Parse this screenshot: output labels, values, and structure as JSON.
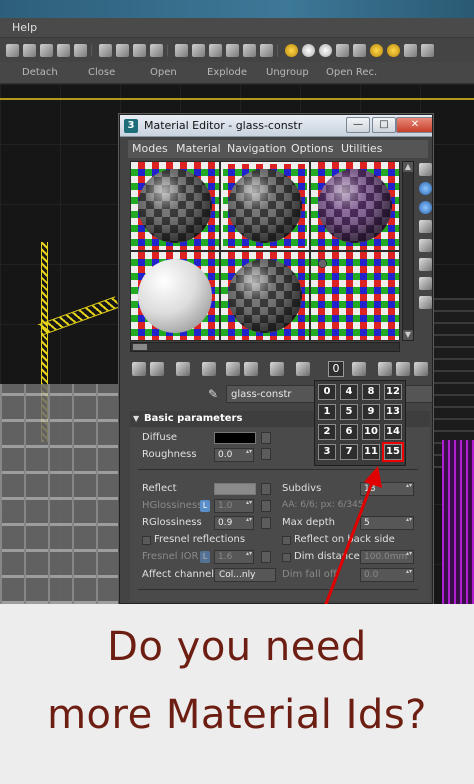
{
  "host": {
    "menu": {
      "help": "Help"
    },
    "labels": [
      "Detach",
      "Close",
      "Open",
      "Explode",
      "Ungroup",
      "Open Rec."
    ]
  },
  "editor": {
    "title": "Material Editor - glass-constr",
    "app_icon_text": "3",
    "window_buttons": {
      "minimize": "—",
      "maximize": "□",
      "close": "✕"
    },
    "menus": [
      "Modes",
      "Material",
      "Navigation",
      "Options",
      "Utilities"
    ],
    "material_name": "glass-constr",
    "material_type": "tl",
    "material_id_button": "0",
    "section_title": "Basic parameters",
    "fields": {
      "diffuse": "Diffuse",
      "roughness": "Roughness",
      "roughness_value": "0.0",
      "reflect": "Reflect",
      "hglossiness": "HGlossiness",
      "hglossiness_value": "1.0",
      "rglossiness": "RGlossiness",
      "rglossiness_value": "0.9",
      "fresnel_reflections": "Fresnel reflections",
      "fresnel_ior": "Fresnel IOR",
      "fresnel_ior_value": "1.6",
      "affect_channels": "Affect channels",
      "affect_channels_value": "Col...nly",
      "subdivs": "Subdivs",
      "subdivs_value": "18",
      "aa": "AA: 6/6; px: 6/345",
      "max_depth": "Max depth",
      "max_depth_value": "5",
      "reflect_on_back_side": "Reflect on back side",
      "dim_distance": "Dim distance",
      "dim_distance_value": "100.0mm",
      "dim_fall_off": "Dim fall off",
      "dim_fall_off_value": "0.0",
      "lock_badge": "L"
    },
    "id_grid": [
      [
        "0",
        "4",
        "8",
        "12"
      ],
      [
        "1",
        "5",
        "9",
        "13"
      ],
      [
        "2",
        "6",
        "10",
        "14"
      ],
      [
        "3",
        "7",
        "11",
        "15"
      ]
    ],
    "highlighted_id": "15"
  },
  "caption": {
    "line1": "Do you need",
    "line2": "more Material Ids?"
  },
  "colors": {
    "caption": "#6d1e12",
    "arrow": "#e00000",
    "crane": "#e6d21a"
  }
}
